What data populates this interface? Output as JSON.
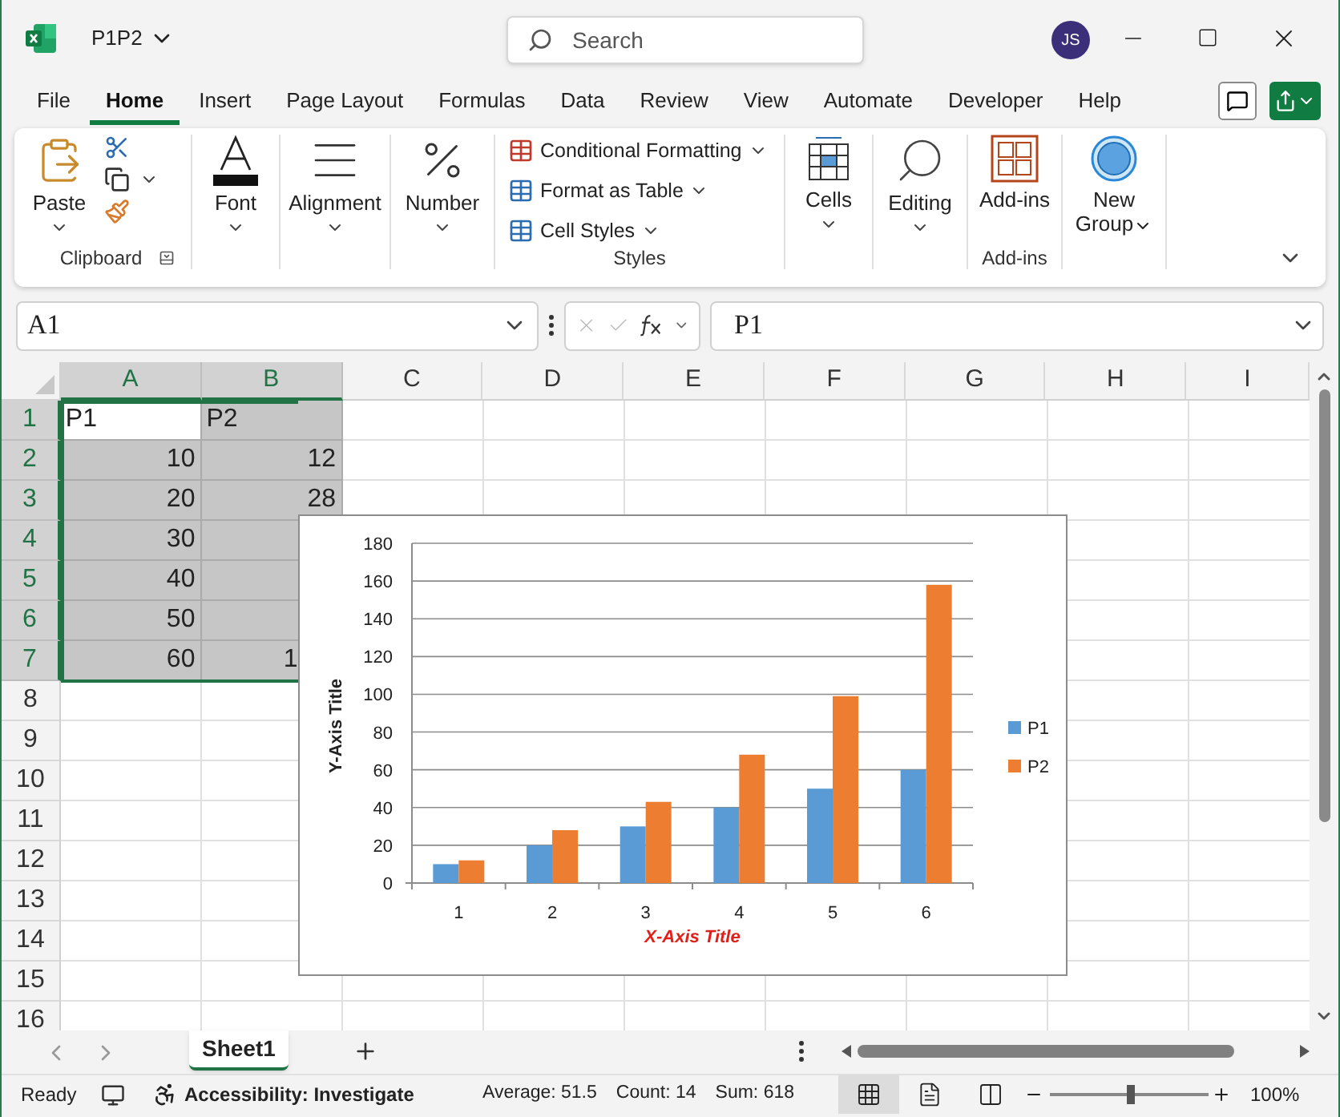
{
  "title_bar": {
    "file_name": "P1P2",
    "search": {
      "placeholder": "Search"
    },
    "avatar": "JS"
  },
  "menu_tabs": [
    {
      "label": "File",
      "selected": false
    },
    {
      "label": "Home",
      "selected": true
    },
    {
      "label": "Insert",
      "selected": false
    },
    {
      "label": "Page Layout",
      "selected": false
    },
    {
      "label": "Formulas",
      "selected": false
    },
    {
      "label": "Data",
      "selected": false
    },
    {
      "label": "Review",
      "selected": false
    },
    {
      "label": "View",
      "selected": false
    },
    {
      "label": "Automate",
      "selected": false
    },
    {
      "label": "Developer",
      "selected": false
    },
    {
      "label": "Help",
      "selected": false
    }
  ],
  "ribbon": {
    "clipboard": {
      "paste": "Paste",
      "label": "Clipboard"
    },
    "font": "Font",
    "alignment": "Alignment",
    "number": "Number",
    "styles": {
      "items": [
        "Conditional Formatting",
        "Format as Table",
        "Cell Styles"
      ],
      "label": "Styles"
    },
    "cells": "Cells",
    "editing": "Editing",
    "addins": {
      "button": "Add-ins",
      "label": "Add-ins"
    },
    "new_group": "New Group"
  },
  "formula_bar": {
    "name_box": "A1",
    "formula": "P1"
  },
  "sheet": {
    "columns": [
      {
        "label": "A",
        "selected": true
      },
      {
        "label": "B",
        "selected": true
      },
      {
        "label": "C",
        "selected": false
      },
      {
        "label": "D",
        "selected": false
      },
      {
        "label": "E",
        "selected": false
      },
      {
        "label": "F",
        "selected": false
      },
      {
        "label": "G",
        "selected": false
      },
      {
        "label": "H",
        "selected": false
      },
      {
        "label": "I",
        "selected": false
      }
    ],
    "rows": [
      {
        "label": "1",
        "selected": true,
        "cells": [
          {
            "value": "P1",
            "kind": "text",
            "selected": true,
            "active": true
          },
          {
            "value": "P2",
            "kind": "text",
            "selected": true,
            "active": false
          }
        ]
      },
      {
        "label": "2",
        "selected": true,
        "cells": [
          {
            "value": "10",
            "kind": "number",
            "selected": true,
            "active": false
          },
          {
            "value": "12",
            "kind": "number",
            "selected": true,
            "active": false
          }
        ]
      },
      {
        "label": "3",
        "selected": true,
        "cells": [
          {
            "value": "20",
            "kind": "number",
            "selected": true,
            "active": false
          },
          {
            "value": "28",
            "kind": "number",
            "selected": true,
            "active": false
          }
        ]
      },
      {
        "label": "4",
        "selected": true,
        "cells": [
          {
            "value": "30",
            "kind": "number",
            "selected": true,
            "active": false
          }
        ]
      },
      {
        "label": "5",
        "selected": true,
        "cells": [
          {
            "value": "40",
            "kind": "number",
            "selected": true,
            "active": false
          }
        ]
      },
      {
        "label": "6",
        "selected": true,
        "cells": [
          {
            "value": "50",
            "kind": "number",
            "selected": true,
            "active": false
          }
        ]
      },
      {
        "label": "7",
        "selected": true,
        "cells": [
          {
            "value": "60",
            "kind": "number",
            "selected": true,
            "active": false
          },
          {
            "value": "1",
            "kind": "partial",
            "selected": true,
            "active": false
          }
        ]
      },
      {
        "label": "8",
        "selected": false
      },
      {
        "label": "9",
        "selected": false
      },
      {
        "label": "10",
        "selected": false
      },
      {
        "label": "11",
        "selected": false
      },
      {
        "label": "12",
        "selected": false
      },
      {
        "label": "13",
        "selected": false
      },
      {
        "label": "14",
        "selected": false
      },
      {
        "label": "15",
        "selected": false
      },
      {
        "label": "16",
        "selected": false
      }
    ],
    "chart": {
      "chart_data": {
        "type": "bar",
        "xlabel": "X-Axis Title",
        "ylabel": "Y-Axis Title",
        "categories": [
          "1",
          "2",
          "3",
          "4",
          "5",
          "6"
        ],
        "series": [
          {
            "name": "P1",
            "color": "#5b9bd5",
            "values": [
              10,
              20,
              30,
              40,
              50,
              60
            ]
          },
          {
            "name": "P2",
            "color": "#ed7d31",
            "values": [
              12,
              28,
              43,
              68,
              99,
              158
            ]
          }
        ],
        "ylim": [
          0,
          180
        ],
        "yticks": [
          0,
          20,
          40,
          60,
          80,
          100,
          120,
          140,
          160,
          180
        ],
        "grid": true,
        "legend": "right"
      }
    }
  },
  "sheet_tabs": [
    {
      "label": "Sheet1",
      "selected": true
    }
  ],
  "status_bar": {
    "mode": "Ready",
    "accessibility": "Accessibility: Investigate",
    "stats": [
      "Average: 51.5",
      "Count: 14",
      "Sum: 618"
    ],
    "view_buttons": [
      {
        "kind": "normal",
        "selected": true
      },
      {
        "kind": "page_layout",
        "selected": false
      },
      {
        "kind": "page_break",
        "selected": false
      }
    ],
    "zoom": {
      "level": 0.5,
      "label": "100%"
    }
  }
}
